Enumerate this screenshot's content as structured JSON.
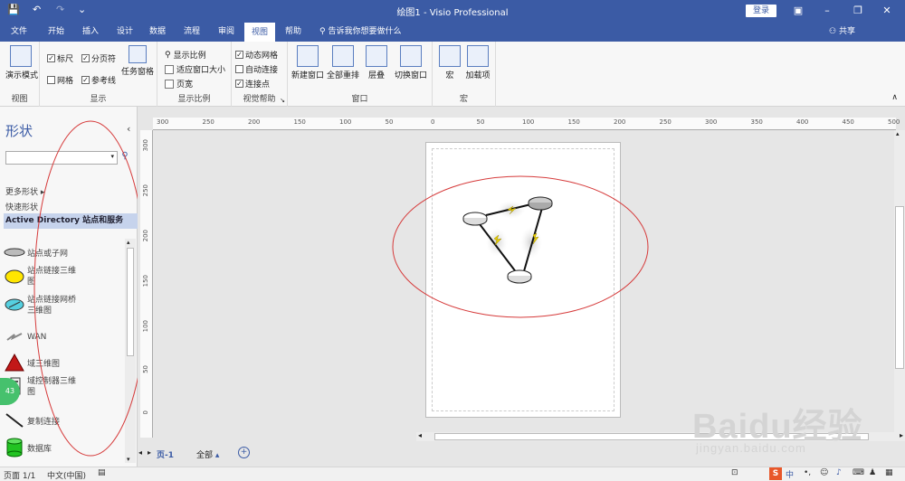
{
  "app": {
    "title": "绘图1 - Visio Professional",
    "login": "登录"
  },
  "tabs": [
    "文件",
    "开始",
    "插入",
    "设计",
    "数据",
    "流程",
    "审阅",
    "视图",
    "帮助"
  ],
  "active_tab": "视图",
  "tell_me": "告诉我你想要做什么",
  "share": "共享",
  "ribbon": {
    "view_group": {
      "btn": "演示模式",
      "label": "视图"
    },
    "show_group": {
      "ruler": "标尺",
      "pagebreak": "分页符",
      "grid": "网格",
      "guides": "参考线",
      "taskpane": "任务窗格",
      "label": "显示"
    },
    "zoom_group": {
      "zoom": "显示比例",
      "fit": "适应窗口大小",
      "pagewidth": "页宽",
      "label": "显示比例"
    },
    "visual_group": {
      "dyngrid": "动态网格",
      "autoconnect": "自动连接",
      "connpoints": "连接点",
      "label": "视觉帮助"
    },
    "window_group": {
      "newwin": "新建窗口",
      "arrange": "全部重排",
      "cascade": "层叠",
      "switch": "切换窗口",
      "label": "窗口"
    },
    "macro_group": {
      "macros": "宏",
      "addins": "加载项",
      "label": "宏"
    }
  },
  "shapes_panel": {
    "title": "形状",
    "search_placeholder": "",
    "more_shapes": "更多形状",
    "quick_shapes": "快速形状",
    "stencil": "Active Directory 站点和服务",
    "items": [
      "站点或子网",
      "站点链接三维图",
      "站点链接网桥三维图",
      "WAN",
      "域三维图",
      "域控制器三维图",
      "复制连接",
      "数据库"
    ],
    "badge": "43"
  },
  "hruler_ticks": [
    "300",
    "250",
    "200",
    "150",
    "100",
    "50",
    "0",
    "50",
    "100",
    "150",
    "200",
    "250",
    "300",
    "350",
    "400",
    "450",
    "500"
  ],
  "vruler_ticks": [
    "300",
    "250",
    "200",
    "150",
    "100",
    "50",
    "0"
  ],
  "page_tabs": {
    "page": "页-1",
    "all": "全部"
  },
  "status": {
    "page": "页面 1/1",
    "lang": "中文(中国)"
  },
  "watermark": {
    "brand": "Baidu经验",
    "url": "jingyan.baidu.com"
  },
  "colors": {
    "accent": "#3b5ba5",
    "annotation": "#d63b3b",
    "lightning": "#e8d000"
  }
}
